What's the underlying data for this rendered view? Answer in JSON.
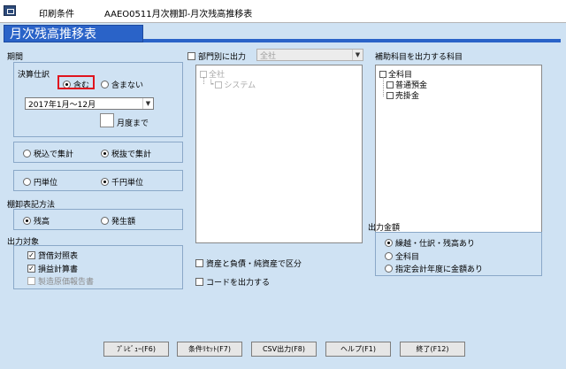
{
  "titlebar": {
    "label_left": "印刷条件",
    "title": "AAEO0511月次棚卸-月次残高推移表"
  },
  "banner": {
    "title": "月次残高推移表"
  },
  "period": {
    "section_label": "期間",
    "settlement_label": "決算仕訳",
    "include_label": "含む",
    "exclude_label": "含まない",
    "include_selected": true,
    "range_value": "2017年1月～12月",
    "month_suffix": "月度まで"
  },
  "tax": {
    "incl_label": "税込で集計",
    "excl_label": "税抜で集計",
    "selected": "excl"
  },
  "unit": {
    "yen_label": "円単位",
    "thousand_label": "千円単位",
    "selected": "thousand"
  },
  "inventory": {
    "section_label": "棚卸表記方法",
    "balance_label": "残高",
    "occurrence_label": "発生額",
    "selected": "balance"
  },
  "output_target": {
    "section_label": "出力対象",
    "items": [
      {
        "label": "貸借対照表",
        "checked": true,
        "disabled": false
      },
      {
        "label": "損益計算書",
        "checked": true,
        "disabled": false
      },
      {
        "label": "製造原価報告書",
        "checked": false,
        "disabled": true
      }
    ]
  },
  "department": {
    "check_label": "部門別に出力",
    "select_value": "全社",
    "tree": [
      {
        "label": "全社",
        "disabled": true
      },
      {
        "label": "システム",
        "disabled": true
      }
    ]
  },
  "sub_accounts": {
    "section_label": "補助科目を出力する科目",
    "tree": [
      {
        "label": "全科目"
      },
      {
        "label": "普通預金"
      },
      {
        "label": "売掛金"
      }
    ]
  },
  "options": {
    "division_label": "資産と負債・純資産で区分",
    "code_label": "コードを出力する"
  },
  "amount": {
    "section_label": "出力金額",
    "items": [
      {
        "label": "繰越・仕訳・残高あり",
        "selected": true
      },
      {
        "label": "全科目",
        "selected": false
      },
      {
        "label": "指定会計年度に金額あり",
        "selected": false
      }
    ]
  },
  "buttons": {
    "preview": "ﾌﾟﾚﾋﾞｭｰ(F6)",
    "reset": "条件ﾘｾｯﾄ(F7)",
    "csv": "CSV出力(F8)",
    "help": "ヘルプ(F1)",
    "exit": "終了(F12)"
  }
}
